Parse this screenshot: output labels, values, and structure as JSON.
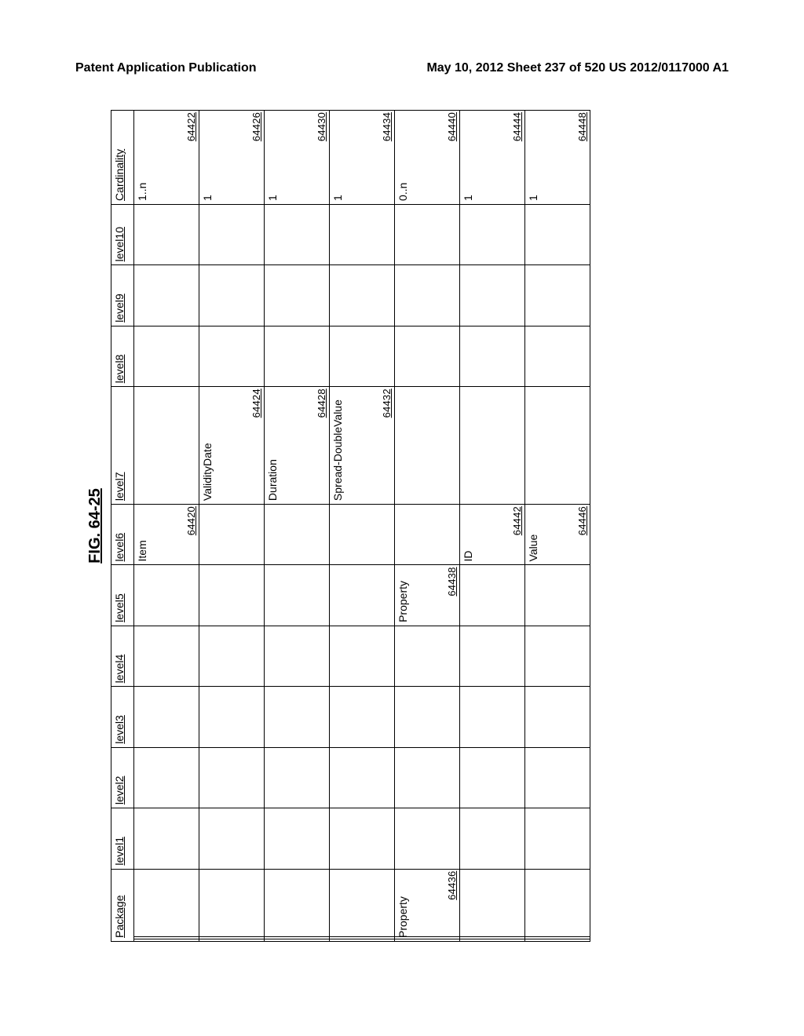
{
  "header": {
    "left": "Patent Application Publication",
    "right": "May 10, 2012  Sheet 237 of 520   US 2012/0117000 A1"
  },
  "figure": {
    "title": "FIG. 64-25",
    "columns": [
      "Package",
      "level1",
      "level2",
      "level3",
      "level4",
      "level5",
      "level6",
      "level7",
      "level8",
      "level9",
      "level10",
      "Cardinality"
    ],
    "rows": [
      {
        "cells": {
          "level6": {
            "text": "Item",
            "ref": "64420"
          },
          "cardinality": {
            "text": "1..n",
            "ref": "64422"
          }
        }
      },
      {
        "cells": {
          "level7": {
            "text": "ValidityDate",
            "ref": "64424"
          },
          "cardinality": {
            "text": "1",
            "ref": "64426"
          }
        }
      },
      {
        "cells": {
          "level7": {
            "text": "Duration",
            "ref": "64428"
          },
          "cardinality": {
            "text": "1",
            "ref": "64430"
          }
        }
      },
      {
        "cells": {
          "level7": {
            "text": "Spread-DoubleValue",
            "ref": "64432"
          },
          "cardinality": {
            "text": "1",
            "ref": "64434"
          }
        }
      },
      {
        "cells": {
          "package": {
            "text": "Property",
            "ref": "64436"
          },
          "level5": {
            "text": "Property",
            "ref": "64438"
          },
          "cardinality": {
            "text": "0..n",
            "ref": "64440"
          }
        }
      },
      {
        "cells": {
          "level6": {
            "text": "ID",
            "ref": "64442"
          },
          "cardinality": {
            "text": "1",
            "ref": "64444"
          }
        }
      },
      {
        "cells": {
          "level6": {
            "text": "Value",
            "ref": "64446"
          },
          "cardinality": {
            "text": "1",
            "ref": "64448"
          }
        }
      }
    ]
  },
  "column_keys": [
    "package",
    "level1",
    "level2",
    "level3",
    "level4",
    "level5",
    "level6",
    "level7",
    "level8",
    "level9",
    "level10",
    "cardinality"
  ]
}
